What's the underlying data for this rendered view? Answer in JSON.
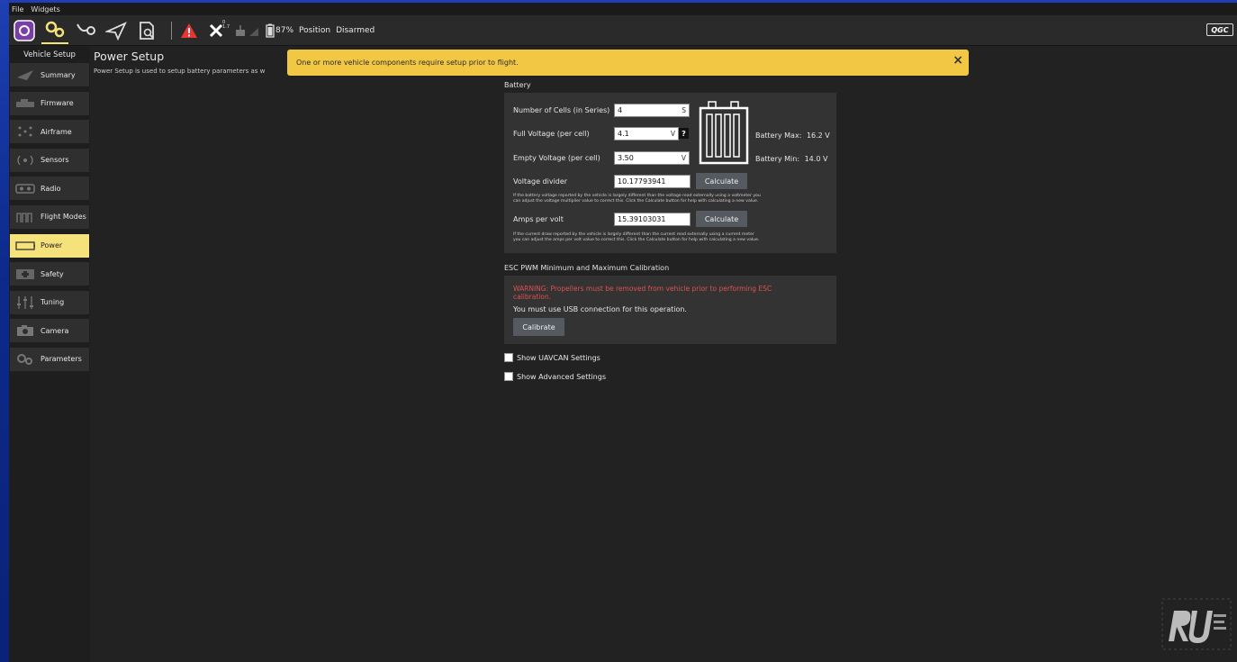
{
  "menu": {
    "file": "File",
    "widgets": "Widgets"
  },
  "toolbar": {
    "gps_count": "0",
    "hdop": "1.7",
    "battery_percent": "87%",
    "flight_mode": "Position",
    "arm_state": "Disarmed",
    "brand": "QGC"
  },
  "sidebar": {
    "title": "Vehicle Setup",
    "items": [
      {
        "label": "Summary"
      },
      {
        "label": "Firmware"
      },
      {
        "label": "Airframe"
      },
      {
        "label": "Sensors"
      },
      {
        "label": "Radio"
      },
      {
        "label": "Flight Modes"
      },
      {
        "label": "Power"
      },
      {
        "label": "Safety"
      },
      {
        "label": "Tuning"
      },
      {
        "label": "Camera"
      },
      {
        "label": "Parameters"
      }
    ]
  },
  "page": {
    "title": "Power Setup",
    "description": "Power Setup is used to setup battery parameters as w"
  },
  "banner": {
    "message": "One or more vehicle components require setup prior to flight.",
    "close": "×"
  },
  "battery": {
    "section_label": "Battery",
    "cells_label": "Number of Cells (in Series)",
    "cells_value": "4",
    "cells_unit": "S",
    "full_label": "Full Voltage (per cell)",
    "full_value": "4.1",
    "full_unit": "V",
    "help_q": "?",
    "empty_label": "Empty Voltage (per cell)",
    "empty_value": "3.50",
    "empty_unit": "V",
    "max_label": "Battery Max:",
    "max_value": "16.2 V",
    "min_label": "Battery Min:",
    "min_value": "14.0 V",
    "divider_label": "Voltage divider",
    "divider_value": "10.17793941",
    "calculate": "Calculate",
    "divider_help_1": "If the battery voltage reported by the vehicle is largely different than the voltage read externally using a voltmeter you",
    "divider_help_2": "can adjust the voltage multiplier value to correct this. Click the Calculate button for help with calculating a new value.",
    "amps_label": "Amps per volt",
    "amps_value": "15.39103031",
    "amps_help_1": "If the current draw reported by the vehicle is largely different than the current read externally using a current meter",
    "amps_help_2": "you can adjust the amps per volt value to correct this. Click the Calculate button for help with calculating a new value."
  },
  "esc": {
    "section_label": "ESC PWM Minimum and Maximum Calibration",
    "warning_1": "WARNING: Propellers must be removed from vehicle prior to performing ESC",
    "warning_2": "calibration.",
    "usb_note": "You must use USB connection for this operation.",
    "calibrate": "Calibrate",
    "warning_color": "#e05050"
  },
  "options": {
    "uavcan": "Show UAVCAN Settings",
    "advanced": "Show Advanced Settings"
  },
  "colors": {
    "accent": "#f5e27a",
    "banner": "#f2c744",
    "background": "#222222",
    "panel": "#333333"
  }
}
